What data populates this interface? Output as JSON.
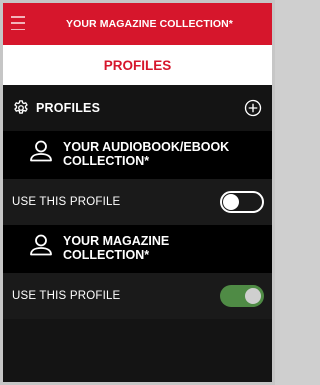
{
  "topbar": {
    "title": "YOUR MAGAZINE COLLECTION*"
  },
  "page": {
    "heading": "PROFILES"
  },
  "profiles_section": {
    "label": "PROFILES",
    "icon": "gear-icon",
    "add_icon": "plus-circle-icon"
  },
  "profiles": [
    {
      "name_line1": "YOUR AUDIOBOOK/EBOOK",
      "name_line2": "COLLECTION*",
      "use_label": "USE THIS PROFILE",
      "enabled": false
    },
    {
      "name_line1": "YOUR MAGAZINE",
      "name_line2": "COLLECTION*",
      "use_label": "USE THIS PROFILE",
      "enabled": true
    }
  ],
  "colors": {
    "brand_red": "#d6162c",
    "toggle_on": "#4f8b45",
    "background": "#141414"
  }
}
